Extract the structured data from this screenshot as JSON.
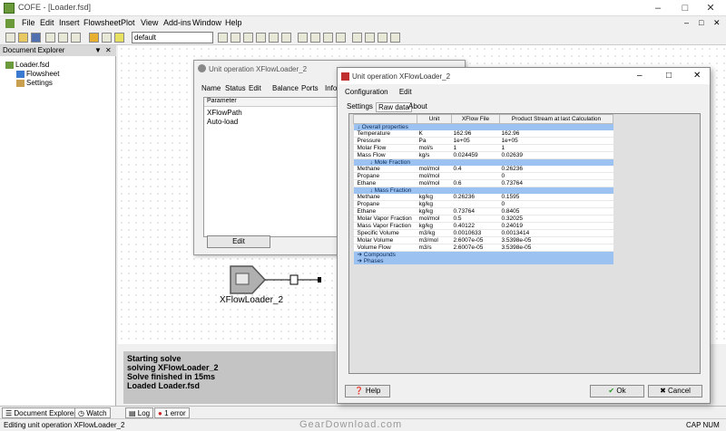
{
  "app": {
    "title": "COFE - [Loader.fsd]",
    "menu": [
      "File",
      "Edit",
      "Insert",
      "Flowsheet",
      "Plot",
      "View",
      "Add-ins",
      "Window",
      "Help"
    ],
    "toolbar_select": "default"
  },
  "explorer": {
    "title": "Document Explorer",
    "tree": [
      "Loader.fsd",
      "Flowsheet",
      "Settings"
    ]
  },
  "canvas": {
    "unit_label": "XFlowLoader_2"
  },
  "log": {
    "lines": [
      "Starting solve",
      "solving XFlowLoader_2",
      "Solve finished in 15ms",
      "Loaded Loader.fsd"
    ]
  },
  "bottom_tabs": {
    "explorer": "Document Explorer",
    "watch": "Watch",
    "log": "Log",
    "errors": "1 error"
  },
  "status": {
    "left": "Editing unit operation XFlowLoader_2",
    "right": "CAP NUM",
    "watermark": "GearDownload.com"
  },
  "dialog1": {
    "title": "Unit operation XFlowLoader_2",
    "tabs": [
      "Name",
      "Status",
      "Edit",
      "Balance",
      "Ports",
      "Info"
    ],
    "list_header": "Parameter",
    "params": [
      "XFlowPath",
      "Auto-load"
    ],
    "edit_button": "Edit"
  },
  "dialog2": {
    "title": "Unit operation XFlowLoader_2",
    "menu": [
      "Configuration",
      "Edit"
    ],
    "tabs": [
      "Settings",
      "Raw data",
      "About"
    ],
    "columns": [
      "",
      "Unit",
      "XFlow File",
      "Product Stream at last Calculation"
    ],
    "rows": [
      {
        "type": "section",
        "label": "Overall properties"
      },
      {
        "type": "row",
        "cells": [
          "Temperature",
          "K",
          "162.96",
          "162.96"
        ]
      },
      {
        "type": "row",
        "cells": [
          "Pressure",
          "Pa",
          "1e+05",
          "1e+05"
        ]
      },
      {
        "type": "row",
        "cells": [
          "Molar Flow",
          "mol/s",
          "1",
          "1"
        ]
      },
      {
        "type": "row",
        "cells": [
          "Mass Flow",
          "kg/s",
          "0.024459",
          "0.02639"
        ]
      },
      {
        "type": "subsection",
        "label": "Mole Fraction"
      },
      {
        "type": "row",
        "cells": [
          "Methane",
          "mol/mol",
          "0.4",
          "0.26236"
        ]
      },
      {
        "type": "row",
        "cells": [
          "Propane",
          "mol/mol",
          "",
          "0"
        ]
      },
      {
        "type": "row",
        "cells": [
          "Ethane",
          "mol/mol",
          "0.6",
          "0.73764"
        ]
      },
      {
        "type": "subsection",
        "label": "Mass Fraction"
      },
      {
        "type": "row",
        "cells": [
          "Methane",
          "kg/kg",
          "0.26236",
          "0.1595"
        ]
      },
      {
        "type": "row",
        "cells": [
          "Propane",
          "kg/kg",
          "",
          "0"
        ]
      },
      {
        "type": "row",
        "cells": [
          "Ethane",
          "kg/kg",
          "0.73764",
          "0.8405"
        ]
      },
      {
        "type": "row",
        "cells": [
          "Molar Vapor Fraction",
          "mol/mol",
          "0.5",
          "0.32025"
        ]
      },
      {
        "type": "row",
        "cells": [
          "Mass Vapor Fraction",
          "kg/kg",
          "0.40122",
          "0.24019"
        ]
      },
      {
        "type": "row",
        "cells": [
          "Specific Volume",
          "m3/kg",
          "0.0010633",
          "0.0013414"
        ]
      },
      {
        "type": "row",
        "cells": [
          "Molar Volume",
          "m3/mol",
          "2.6007e-05",
          "3.5398e-05"
        ]
      },
      {
        "type": "row",
        "cells": [
          "Volume Flow",
          "m3/s",
          "2.6007e-05",
          "3.5398e-05"
        ]
      },
      {
        "type": "collapsed",
        "label": "Compounds"
      },
      {
        "type": "collapsed",
        "label": "Phases"
      }
    ],
    "help_button": "Help",
    "ok_button": "Ok",
    "cancel_button": "Cancel"
  },
  "colors": {
    "section": "#9bc2f0",
    "ok_check": "#2a9a2a",
    "cancel_x": "#333333",
    "error": "#d02020"
  }
}
